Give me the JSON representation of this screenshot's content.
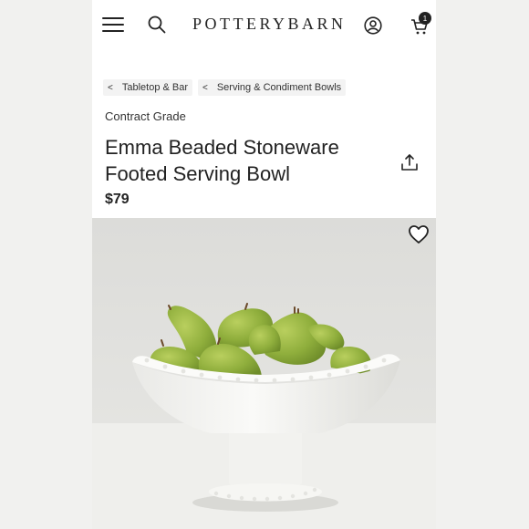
{
  "header": {
    "logo": "POTTERYBARN",
    "cart_count": "1",
    "icons": [
      "hamburger-menu-icon",
      "search-icon",
      "account-icon",
      "cart-icon"
    ]
  },
  "breadcrumb": [
    {
      "label": "Tabletop & Bar"
    },
    {
      "label": "Serving & Condiment Bowls"
    }
  ],
  "product": {
    "grade": "Contract Grade",
    "title_line1": "Emma Beaded Stoneware",
    "title_line2": "Footed Serving Bowl",
    "price": "$79"
  },
  "icons": {
    "share": "share-icon",
    "favorite": "heart-icon"
  },
  "colors": {
    "text": "#222222",
    "breadcrumb_bg": "#f3f3f3",
    "pear_green": "#8fae3c",
    "bowl_white": "#f7f7f4"
  }
}
